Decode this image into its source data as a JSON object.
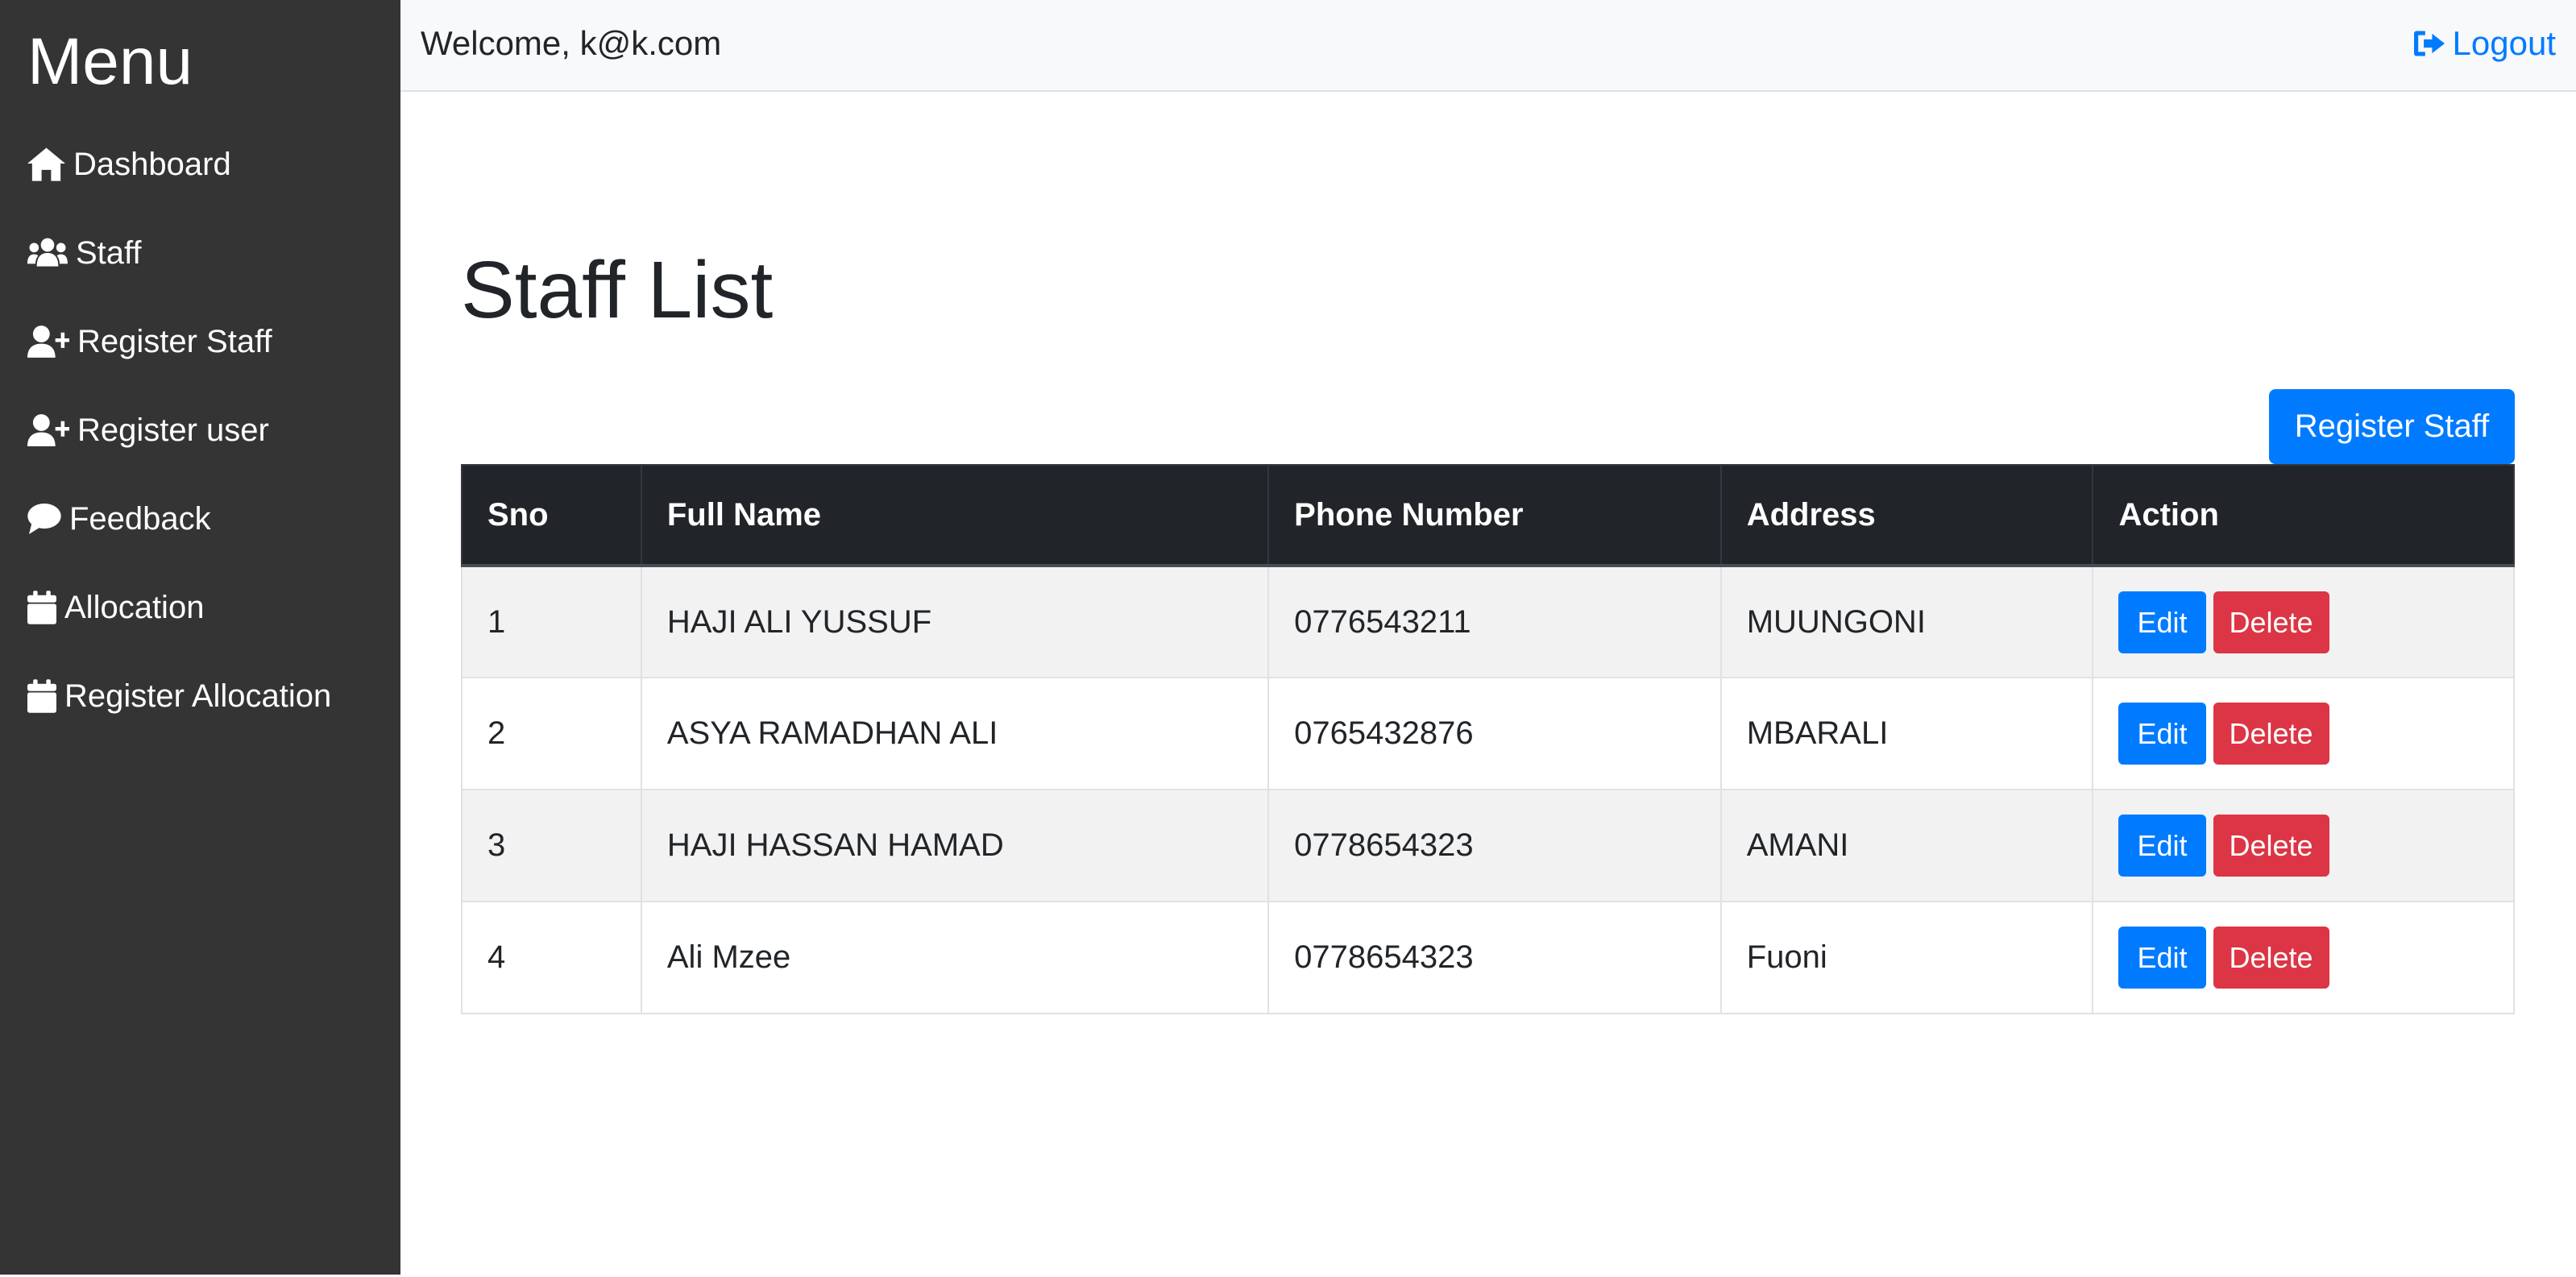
{
  "sidebar": {
    "title": "Menu",
    "items": [
      {
        "label": "Dashboard",
        "icon": "home-icon"
      },
      {
        "label": "Staff",
        "icon": "users-icon"
      },
      {
        "label": "Register Staff",
        "icon": "user-plus-icon"
      },
      {
        "label": "Register user",
        "icon": "user-plus-icon"
      },
      {
        "label": "Feedback",
        "icon": "comment-icon"
      },
      {
        "label": "Allocation",
        "icon": "calendar-icon"
      },
      {
        "label": "Register Allocation",
        "icon": "calendar-icon"
      }
    ]
  },
  "header": {
    "welcome": "Welcome, k@k.com",
    "logout_label": "Logout"
  },
  "main": {
    "title": "Staff List",
    "register_button": "Register Staff",
    "table": {
      "columns": [
        "Sno",
        "Full Name",
        "Phone Number",
        "Address",
        "Action"
      ],
      "rows": [
        {
          "sno": "1",
          "name": "HAJI ALI YUSSUF",
          "phone": "0776543211",
          "address": "MUUNGONI"
        },
        {
          "sno": "2",
          "name": "ASYA RAMADHAN ALI",
          "phone": "0765432876",
          "address": "MBARALI"
        },
        {
          "sno": "3",
          "name": "HAJI HASSAN HAMAD",
          "phone": "0778654323",
          "address": "AMANI"
        },
        {
          "sno": "4",
          "name": "Ali Mzee",
          "phone": "0778654323",
          "address": "Fuoni"
        }
      ],
      "edit_label": "Edit",
      "delete_label": "Delete"
    }
  },
  "colors": {
    "sidebar_bg": "#343434",
    "primary": "#007bff",
    "danger": "#dc3545",
    "table_head_bg": "#212529"
  }
}
